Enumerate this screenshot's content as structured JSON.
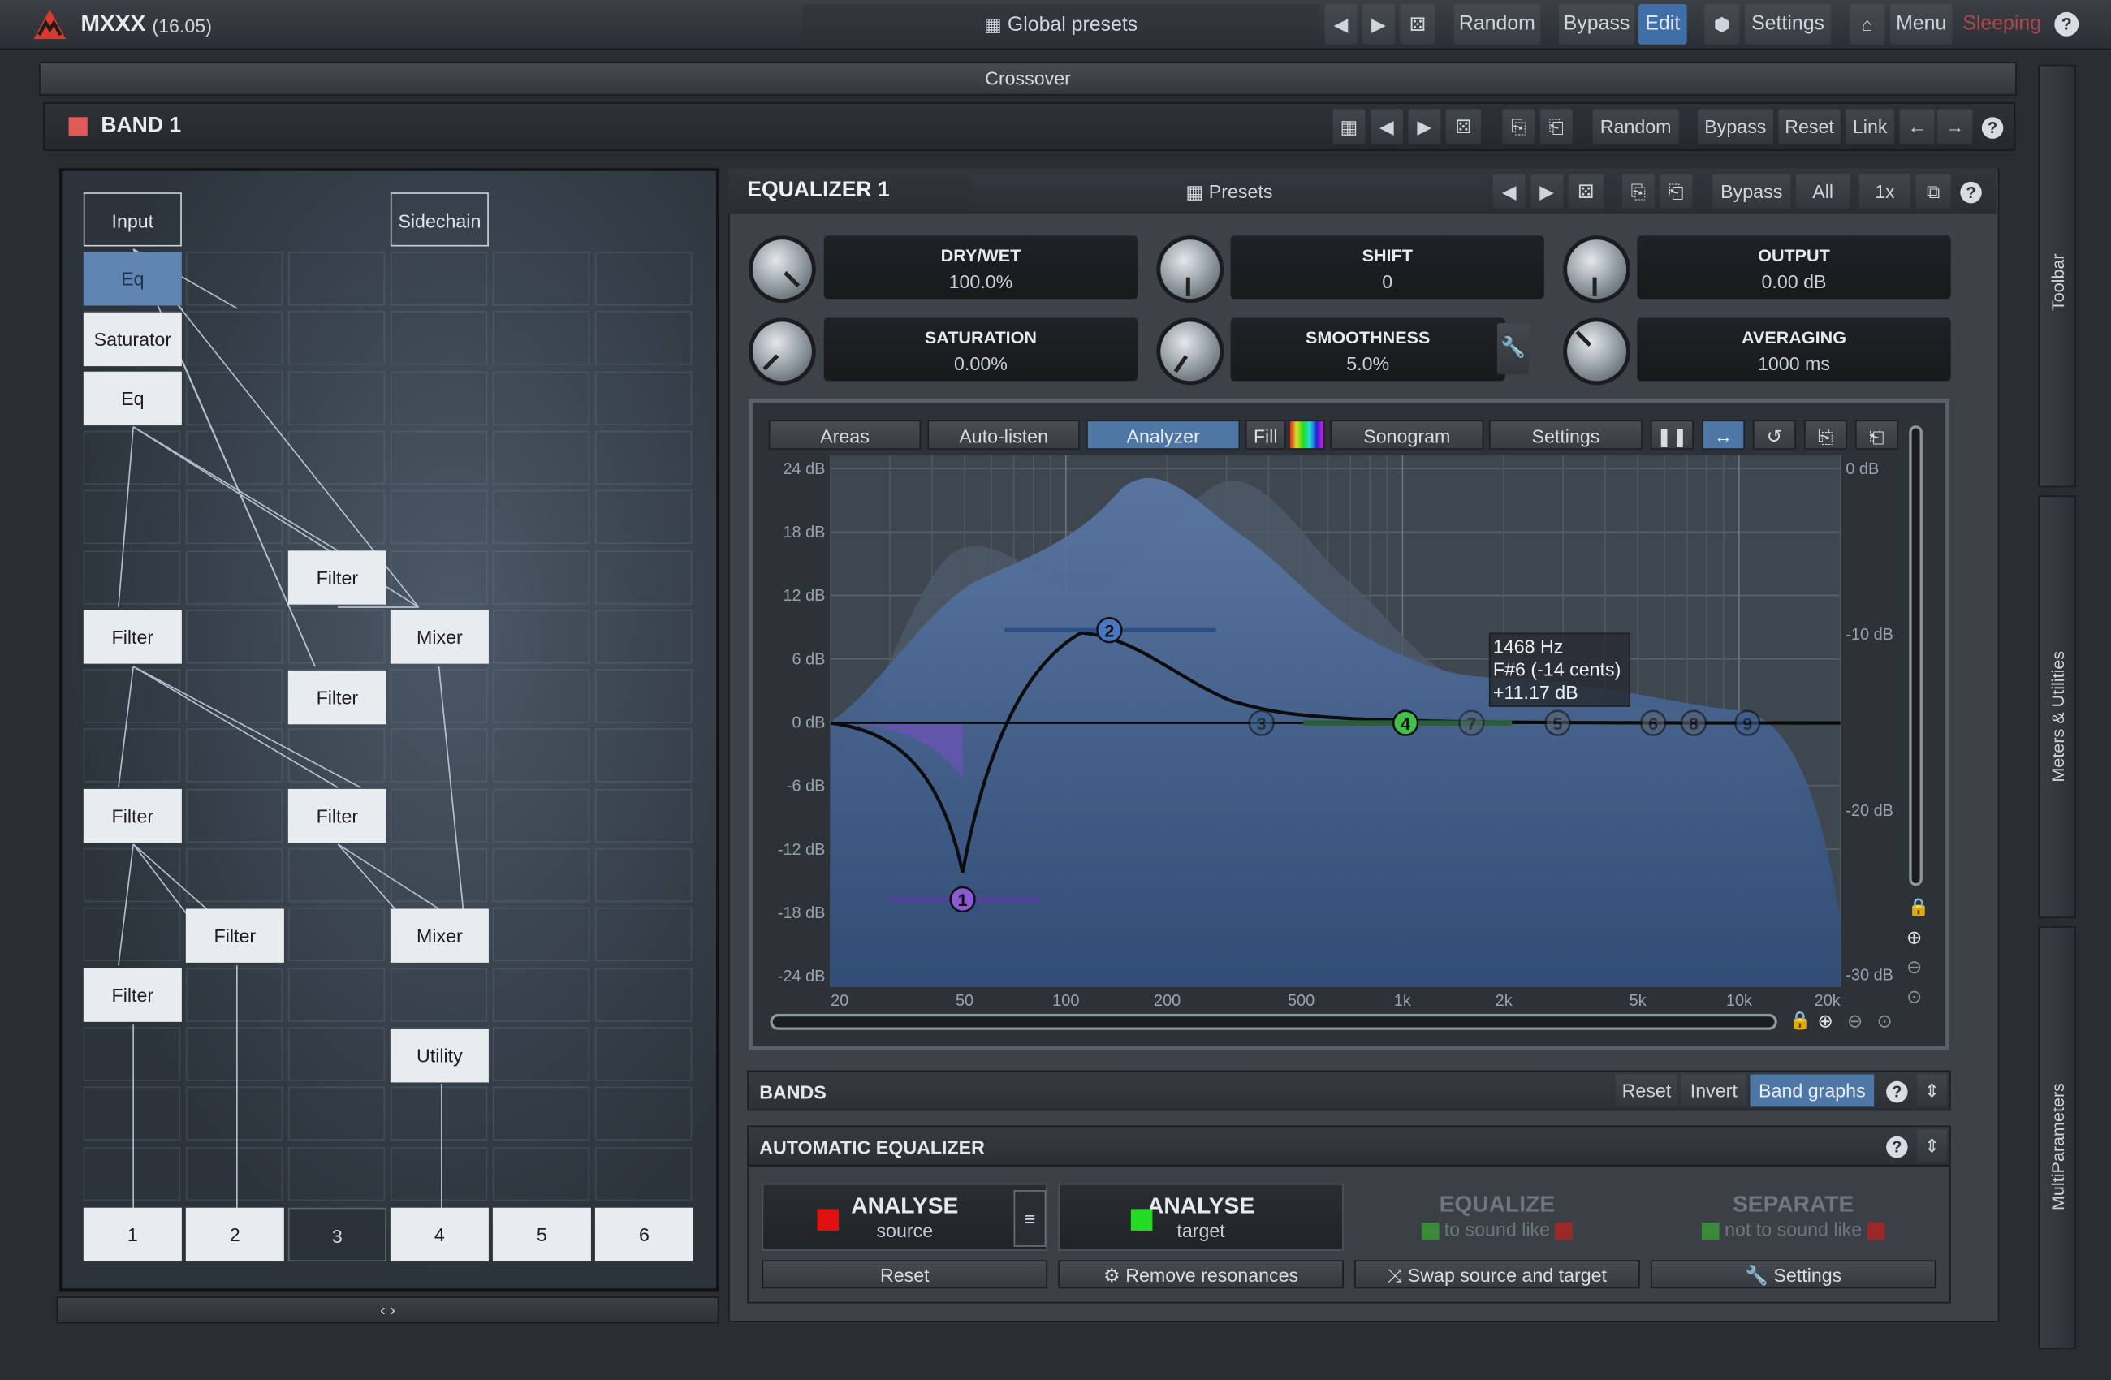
{
  "app": {
    "name": "MXXX",
    "version": "(16.05)"
  },
  "topbar": {
    "global_presets": "Global presets",
    "random": "Random",
    "bypass": "Bypass",
    "edit": "Edit",
    "settings": "Settings",
    "menu": "Menu",
    "sleeping": "Sleeping"
  },
  "crossover": "Crossover",
  "band": {
    "title": "BAND 1",
    "random": "Random",
    "bypass": "Bypass",
    "reset": "Reset",
    "link": "Link"
  },
  "routing": {
    "input": "Input",
    "sidechain": "Sidechain",
    "nodes": [
      "Eq",
      "Saturator",
      "Eq",
      "Filter",
      "Filter",
      "Mixer",
      "Filter",
      "Filter",
      "Filter",
      "Filter",
      "Mixer",
      "Filter",
      "Utility"
    ],
    "outputs": [
      "1",
      "2",
      "3",
      "4",
      "5",
      "6"
    ],
    "scroll": "‹ ›"
  },
  "equalizer": {
    "title": "EQUALIZER 1",
    "presets": "Presets",
    "bypass": "Bypass",
    "all": "All",
    "zoom": "1x",
    "params": [
      {
        "name": "DRY/WET",
        "value": "100.0%"
      },
      {
        "name": "SHIFT",
        "value": "0"
      },
      {
        "name": "OUTPUT",
        "value": "0.00 dB"
      },
      {
        "name": "SATURATION",
        "value": "0.00%"
      },
      {
        "name": "SMOOTHNESS",
        "value": "5.0%"
      },
      {
        "name": "AVERAGING",
        "value": "1000 ms"
      }
    ]
  },
  "graph": {
    "buttons": {
      "areas": "Areas",
      "autolisten": "Auto-listen",
      "analyzer": "Analyzer",
      "fill": "Fill",
      "sonogram": "Sonogram",
      "settings": "Settings"
    },
    "db_left": [
      "24 dB",
      "18 dB",
      "12 dB",
      "6 dB",
      "0 dB",
      "-6 dB",
      "-12 dB",
      "-18 dB",
      "-24 dB"
    ],
    "db_right": [
      "0 dB",
      "-10 dB",
      "-20 dB",
      "-30 dB"
    ],
    "freq": [
      "20",
      "50",
      "100",
      "200",
      "500",
      "1k",
      "2k",
      "5k",
      "10k",
      "20k"
    ],
    "tooltip": {
      "freq": "1468 Hz",
      "note": "F#6 (-14 cents)",
      "gain": "+11.17 dB"
    },
    "band_markers": [
      "1",
      "2",
      "3",
      "4",
      "5",
      "6",
      "7",
      "8",
      "9"
    ]
  },
  "bands_section": {
    "title": "BANDS",
    "reset": "Reset",
    "invert": "Invert",
    "band_graphs": "Band graphs"
  },
  "auto_eq": {
    "title": "AUTOMATIC EQUALIZER",
    "analyse_source": {
      "title": "ANALYSE",
      "sub": "source"
    },
    "analyse_target": {
      "title": "ANALYSE",
      "sub": "target"
    },
    "equalize": {
      "title": "EQUALIZE",
      "sub": "to sound like"
    },
    "separate": {
      "title": "SEPARATE",
      "sub": "not to sound like"
    },
    "reset": "Reset",
    "remove_resonances": "Remove resonances",
    "swap": "Swap source and target",
    "settings": "Settings"
  },
  "side_tabs": {
    "toolbar": "Toolbar",
    "meters": "Meters & Utilities",
    "multiparams": "MultiParameters"
  },
  "colors": {
    "accent": "#4e77a6",
    "band_red": "#e05a5a",
    "source_red": "#e01010",
    "target_green": "#22dd22"
  }
}
